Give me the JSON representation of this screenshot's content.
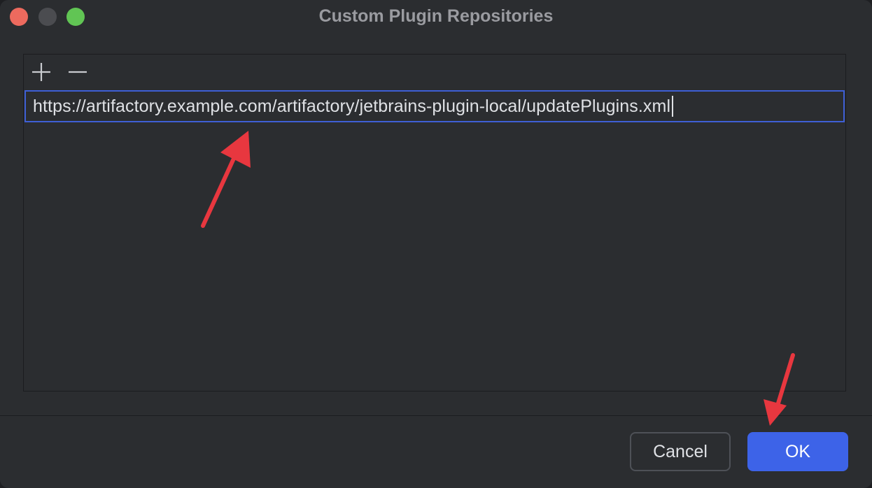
{
  "window": {
    "title": "Custom Plugin Repositories"
  },
  "toolbar": {
    "add_icon": "plus-icon",
    "remove_icon": "minus-icon"
  },
  "repository": {
    "url": "https://artifactory.example.com/artifactory/jetbrains-plugin-local/updatePlugins.xml"
  },
  "buttons": {
    "cancel_label": "Cancel",
    "ok_label": "OK"
  },
  "colors": {
    "accent": "#3d63e8",
    "focus_border": "#3e5fd6",
    "annotation_arrow": "#e8373f",
    "close": "#ed6a5e",
    "minimize": "#4b4c50",
    "zoom": "#61c554"
  }
}
